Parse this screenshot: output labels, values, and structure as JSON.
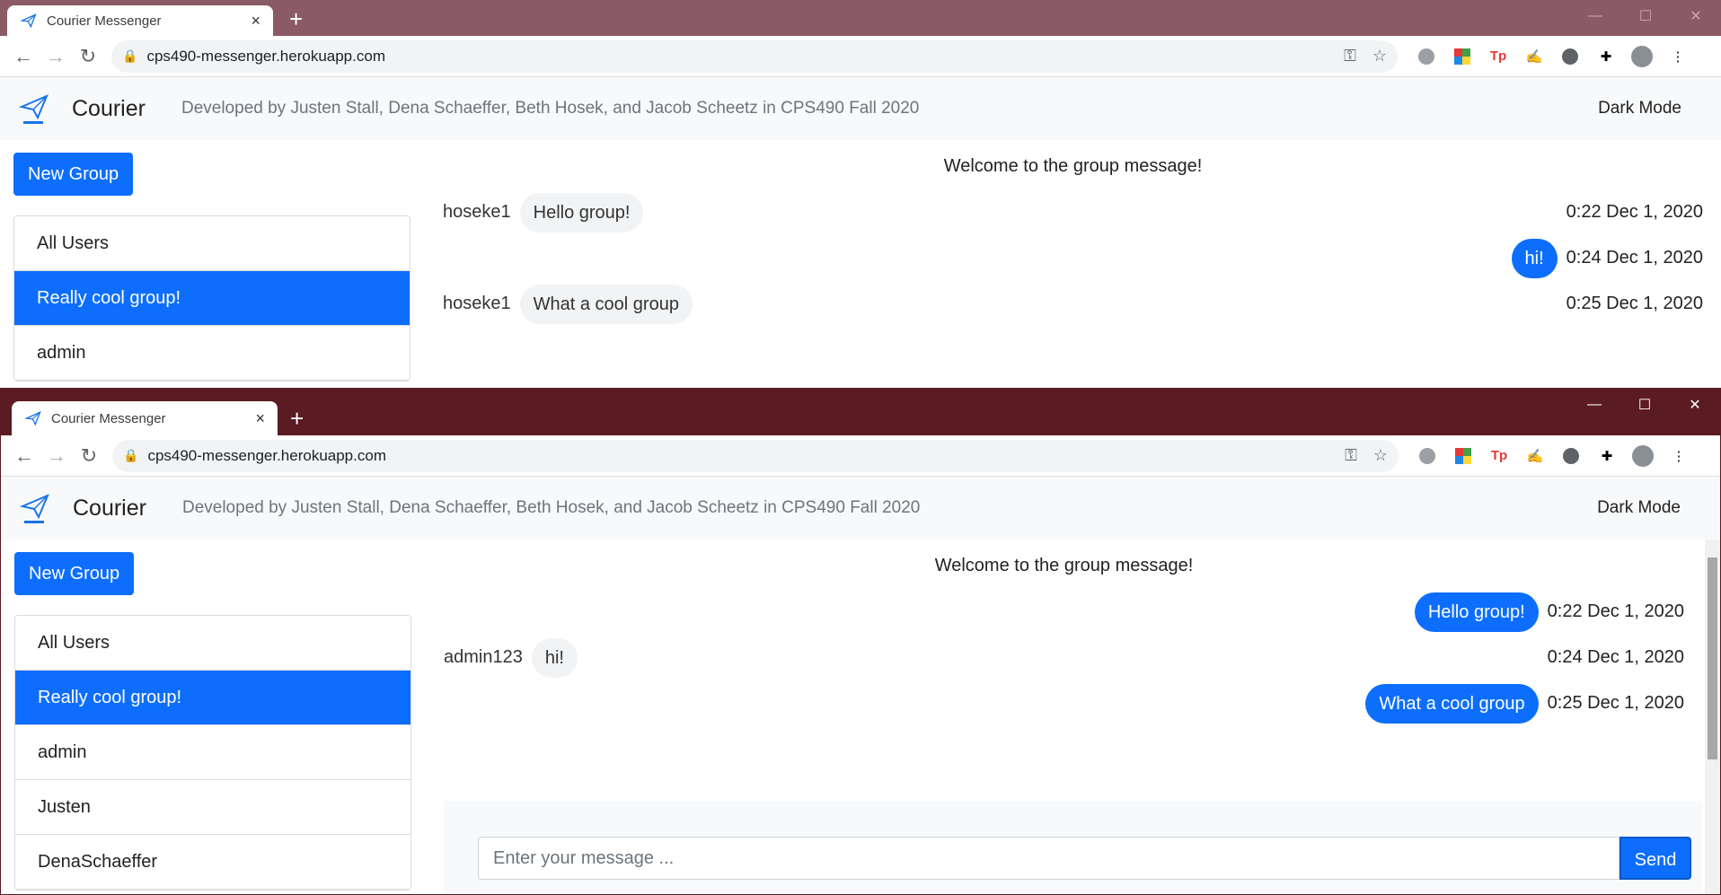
{
  "browser": {
    "tab_title": "Courier Messenger",
    "tab_close": "×",
    "new_tab": "+",
    "url": "cps490-messenger.herokuapp.com",
    "window_controls": [
      "—",
      "☐",
      "✕"
    ]
  },
  "app": {
    "brand": "Courier",
    "developed_by": "Developed by Justen Stall, Dena Schaeffer, Beth Hosek, and Jacob Scheetz in CPS490 Fall 2020",
    "dark_mode": "Dark Mode",
    "new_group": "New Group",
    "welcome": "Welcome to the group message!",
    "accent": "#0d6efd"
  },
  "window1": {
    "groups": [
      "All Users",
      "Really cool group!",
      "admin"
    ],
    "active_group": "Really cool group!",
    "messages": [
      {
        "sender": "hoseke1",
        "text": "Hello group!",
        "time": "0:22 Dec 1, 2020"
      },
      {
        "sender": "",
        "text": "hi!",
        "time": "0:24 Dec 1, 2020"
      },
      {
        "sender": "hoseke1",
        "text": "What a cool group",
        "time": "0:25 Dec 1, 2020"
      }
    ]
  },
  "window2": {
    "groups": [
      "All Users",
      "Really cool group!",
      "admin",
      "Justen",
      "DenaSchaeffer"
    ],
    "active_group": "Really cool group!",
    "messages": [
      {
        "sender": "",
        "text": "Hello group!",
        "time": "0:22 Dec 1, 2020"
      },
      {
        "sender": "admin123",
        "text": "hi!",
        "time": "0:24 Dec 1, 2020"
      },
      {
        "sender": "",
        "text": "What a cool group",
        "time": "0:25 Dec 1, 2020"
      }
    ],
    "input_placeholder": "Enter your message ...",
    "send": "Send"
  }
}
